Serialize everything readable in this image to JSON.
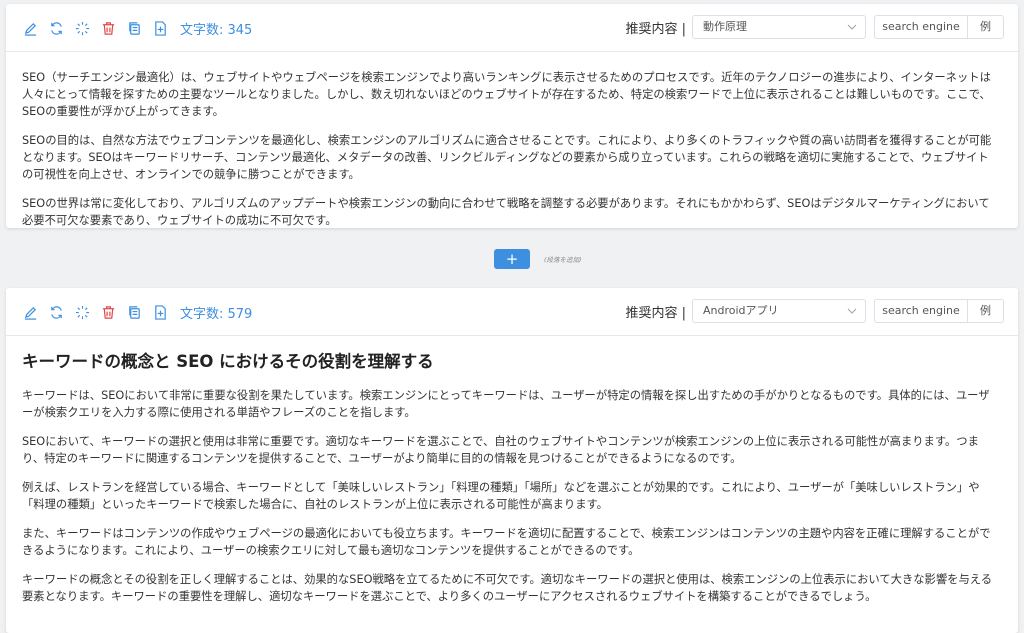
{
  "colors": {
    "accent": "#3d8fe0",
    "delete": "#e04848"
  },
  "blocks": [
    {
      "char_count_label": "文字数: 345",
      "rec_label": "推奨内容 |",
      "select_value": "動作原理",
      "search_engine_label": "search engine",
      "example_label": "例",
      "paragraphs": [
        "SEO（サーチエンジン最適化）は、ウェブサイトやウェブページを検索エンジンでより高いランキングに表示させるためのプロセスです。近年のテクノロジーの進歩により、インターネットは人々にとって情報を探すための主要なツールとなりました。しかし、数え切れないほどのウェブサイトが存在するため、特定の検索ワードで上位に表示されることは難しいものです。ここで、SEOの重要性が浮かび上がってきます。",
        "SEOの目的は、自然な方法でウェブコンテンツを最適化し、検索エンジンのアルゴリズムに適合させることです。これにより、より多くのトラフィックや質の高い訪問者を獲得することが可能となります。SEOはキーワードリサーチ、コンテンツ最適化、メタデータの改善、リンクビルディングなどの要素から成り立っています。これらの戦略を適切に実施することで、ウェブサイトの可視性を向上させ、オンラインでの競争に勝つことができます。",
        "SEOの世界は常に変化しており、アルゴリズムのアップデートや検索エンジンの動向に合わせて戦略を調整する必要があります。それにもかかわらず、SEOはデジタルマーケティングにおいて必要不可欠な要素であり、ウェブサイトの成功に不可欠です。"
      ]
    },
    {
      "char_count_label": "文字数: 579",
      "rec_label": "推奨内容 |",
      "select_value": "Androidアプリ",
      "search_engine_label": "search engine",
      "example_label": "例",
      "heading": "キーワードの概念と SEO におけるその役割を理解する",
      "paragraphs": [
        "キーワードは、SEOにおいて非常に重要な役割を果たしています。検索エンジンにとってキーワードは、ユーザーが特定の情報を探し出すための手がかりとなるものです。具体的には、ユーザーが検索クエリを入力する際に使用される単語やフレーズのことを指します。",
        "SEOにおいて、キーワードの選択と使用は非常に重要です。適切なキーワードを選ぶことで、自社のウェブサイトやコンテンツが検索エンジンの上位に表示される可能性が高まります。つまり、特定のキーワードに関連するコンテンツを提供することで、ユーザーがより簡単に目的の情報を見つけることができるようになるのです。",
        "例えば、レストランを経営している場合、キーワードとして「美味しいレストラン」「料理の種類」「場所」などを選ぶことが効果的です。これにより、ユーザーが「美味しいレストラン」や「料理の種類」といったキーワードで検索した場合に、自社のレストランが上位に表示される可能性が高まります。",
        "また、キーワードはコンテンツの作成やウェブページの最適化においても役立ちます。キーワードを適切に配置することで、検索エンジンはコンテンツの主題や内容を正確に理解することができるようになります。これにより、ユーザーの検索クエリに対して最も適切なコンテンツを提供することができるのです。",
        "キーワードの概念とその役割を正しく理解することは、効果的なSEO戦略を立てるために不可欠です。適切なキーワードの選択と使用は、検索エンジンの上位表示において大きな影響を与える要素となります。キーワードの重要性を理解し、適切なキーワードを選ぶことで、より多くのユーザーにアクセスされるウェブサイトを構築することができるでしょう。"
      ]
    }
  ],
  "add_block": {
    "button_label": "+",
    "hint": "(段落を追加)"
  }
}
